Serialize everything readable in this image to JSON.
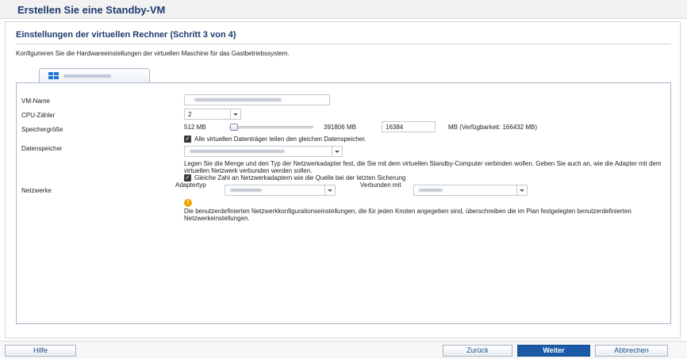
{
  "window": {
    "title": "Erstellen Sie eine Standby-VM"
  },
  "step": {
    "title": "Einstellungen der virtuellen Rechner (Schritt 3 von 4)",
    "description": "Konfigurieren Sie die Hardwareeinstellungen der virtuellen Maschine für das Gastbetriebssystem."
  },
  "tab": {
    "icon": "windows-logo-icon"
  },
  "form": {
    "vm_name_label": "VM-Name",
    "cpu_label": "CPU-Zähler",
    "cpu_value": "2",
    "memory_label": "Speichergröße",
    "memory_min": "512 MB",
    "memory_max": "391806 MB",
    "memory_value": "16384",
    "memory_avail": "MB (Verfügbarkeit: 166432 MB)",
    "memory_level_fraction": 0.04,
    "datastore_label": "Datenspeicher",
    "datastore_checkbox": "Alle virtuellen Datenträger teilen den gleichen Datenspeicher.",
    "network_info": "Legen Sie die Menge und den Typ der Netzwerkadapter fest, die Sie mit dem virtuellen Standby-Computer verbinden wollen. Geben Sie auch an, wie die Adapter mit dem virtuellen Netzwerk verbunden werden sollen.",
    "network_checkbox": "Gleiche Zahl an Netzwerkadaptern wie die Quelle bei der letzten Sicherung",
    "networks_label": "Netzwerke",
    "adapter_type_label": "Adaptertyp",
    "connected_with_label": "Verbunden mit",
    "warning_text": "Die benutzerdefinierten Netzwerkkonfigurationseinstellungen, die für jeden Knoten angegeben sind, überschreiben die im Plan festgelegten benutzerdefinierten Netzwerkeinstellungen."
  },
  "buttons": {
    "help": "Hilfe",
    "back": "Zurück",
    "next": "Weiter",
    "cancel": "Abbrechen"
  },
  "colors": {
    "title": "#1d3b6e",
    "primary_button": "#1b5aa6",
    "warning": "#f0a800",
    "windows_logo": "#1c76d2"
  }
}
